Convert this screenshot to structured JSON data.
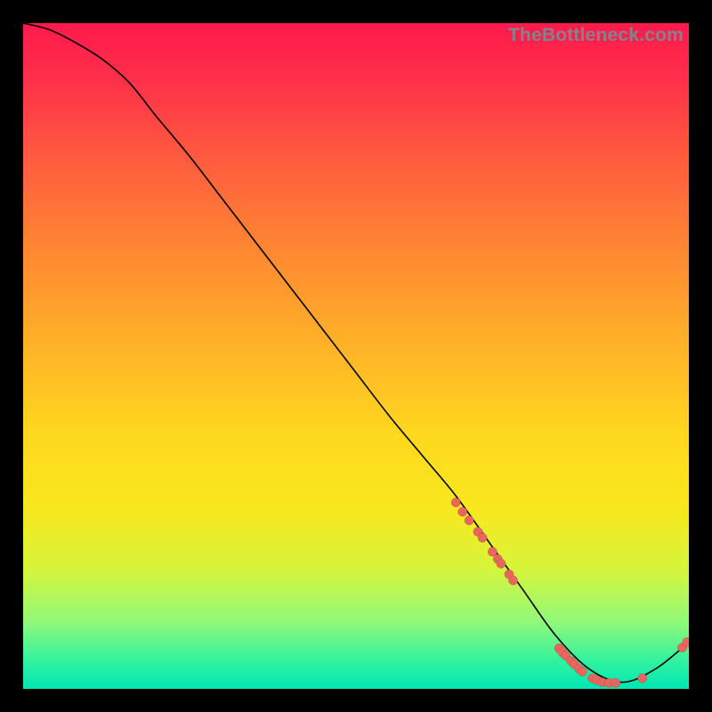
{
  "watermark": "TheBottleneck.com",
  "chart_data": {
    "type": "line",
    "title": "",
    "xlabel": "",
    "ylabel": "",
    "xlim": [
      0,
      100
    ],
    "ylim": [
      0,
      100
    ],
    "grid": false,
    "legend": false,
    "background_gradient": {
      "top": "#ff1a4d",
      "bottom": "#00e6b5"
    },
    "series": [
      {
        "name": "curve",
        "x": [
          0,
          4,
          8,
          12,
          16,
          20,
          25,
          30,
          35,
          40,
          45,
          50,
          55,
          60,
          65,
          70,
          75,
          80,
          85,
          90,
          95,
          100
        ],
        "y": [
          100,
          99,
          97,
          94.5,
          91,
          86,
          80,
          73.5,
          67,
          60.5,
          54,
          47.5,
          41,
          35,
          29,
          22,
          15,
          8,
          3,
          1,
          3,
          7
        ]
      }
    ],
    "scatter_points": {
      "name": "markers",
      "points": [
        {
          "x": 65.0,
          "y": 28.0
        },
        {
          "x": 66.0,
          "y": 26.6
        },
        {
          "x": 67.0,
          "y": 25.3
        },
        {
          "x": 68.3,
          "y": 23.6
        },
        {
          "x": 69.0,
          "y": 22.7
        },
        {
          "x": 70.5,
          "y": 20.6
        },
        {
          "x": 71.3,
          "y": 19.5
        },
        {
          "x": 71.8,
          "y": 18.8
        },
        {
          "x": 73.0,
          "y": 17.2
        },
        {
          "x": 73.6,
          "y": 16.3
        },
        {
          "x": 80.5,
          "y": 6.1
        },
        {
          "x": 81.0,
          "y": 5.5
        },
        {
          "x": 81.5,
          "y": 5.0
        },
        {
          "x": 82.3,
          "y": 4.2
        },
        {
          "x": 82.8,
          "y": 3.7
        },
        {
          "x": 83.5,
          "y": 3.0
        },
        {
          "x": 84.0,
          "y": 2.6
        },
        {
          "x": 85.5,
          "y": 1.6
        },
        {
          "x": 86.2,
          "y": 1.3
        },
        {
          "x": 87.0,
          "y": 1.0
        },
        {
          "x": 88.0,
          "y": 0.9
        },
        {
          "x": 89.0,
          "y": 0.9
        },
        {
          "x": 93.0,
          "y": 1.6
        },
        {
          "x": 99.0,
          "y": 6.2
        },
        {
          "x": 99.7,
          "y": 7.0
        }
      ]
    }
  }
}
